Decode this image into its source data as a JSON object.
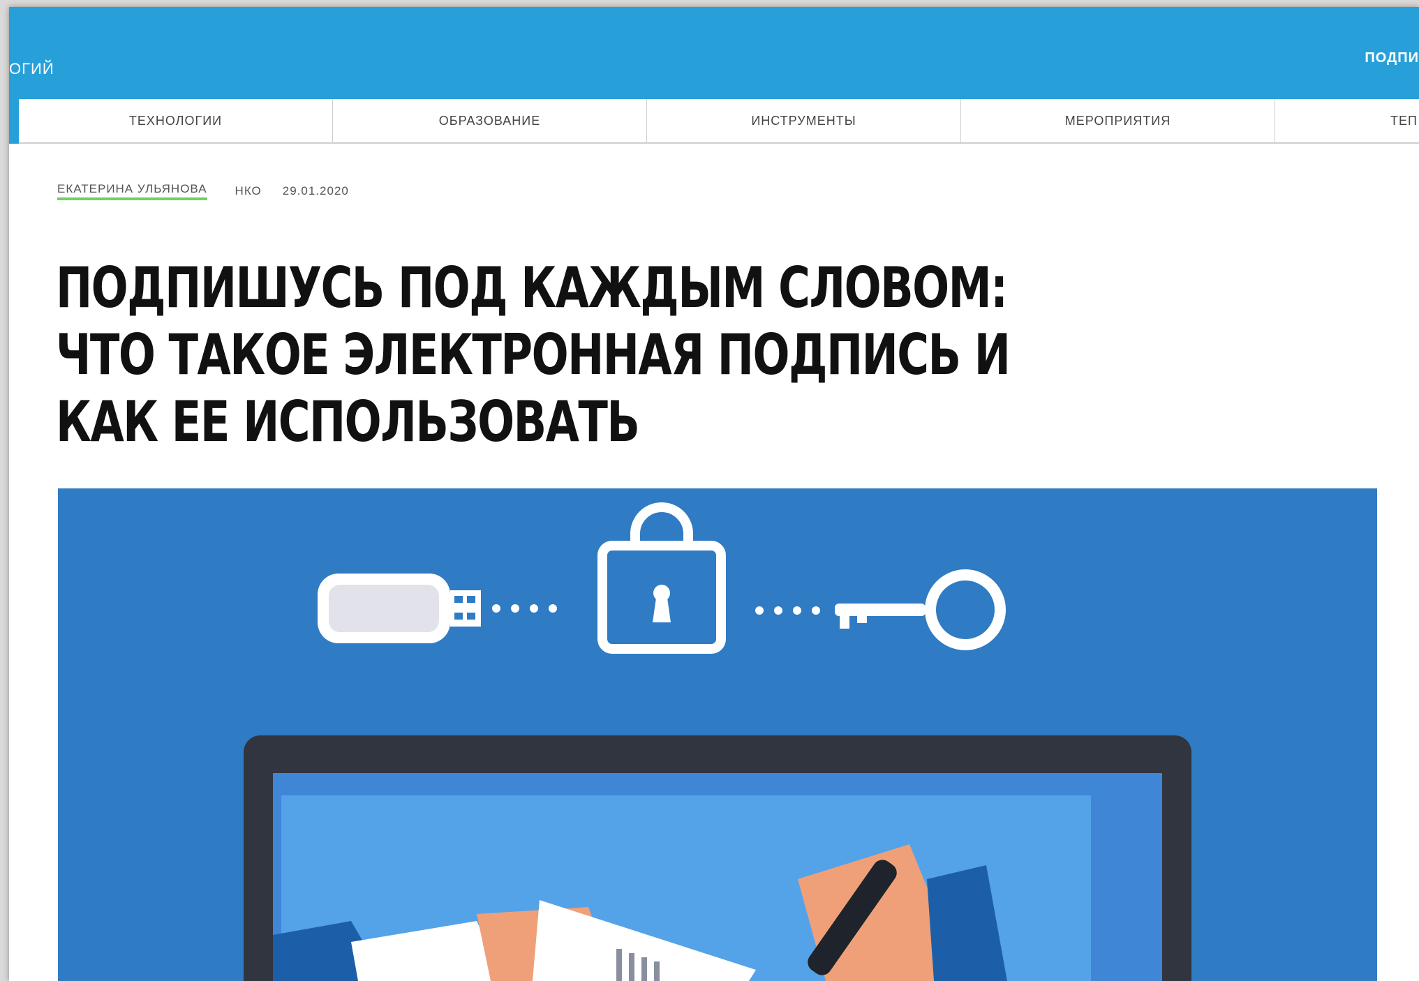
{
  "header": {
    "brand_fragment": "ОГИЙ",
    "subscribe_label": "ПОДПИ"
  },
  "nav": {
    "items": [
      {
        "label": "ТЕХНОЛОГИИ"
      },
      {
        "label": "ОБРАЗОВАНИЕ"
      },
      {
        "label": "ИНСТРУМЕНТЫ"
      },
      {
        "label": "МЕРОПРИЯТИЯ"
      },
      {
        "label": "ТЕП"
      }
    ]
  },
  "article": {
    "author": "ЕКАТЕРИНА УЛЬЯНОВА",
    "category": "НКО",
    "date": "29.01.2020",
    "title": "ПОДПИШУСЬ ПОД КАЖДЫМ СЛОВОМ: ЧТО ТАКОЕ ЭЛЕКТРОННАЯ ПОДПИСЬ И КАК ЕЕ ИСПОЛЬЗОВАТЬ",
    "hero_image": "electronic-signature-illustration"
  },
  "colors": {
    "header_blue": "#27a0da",
    "hero_blue": "#2f7bc4",
    "author_underline": "#6fd35a"
  }
}
